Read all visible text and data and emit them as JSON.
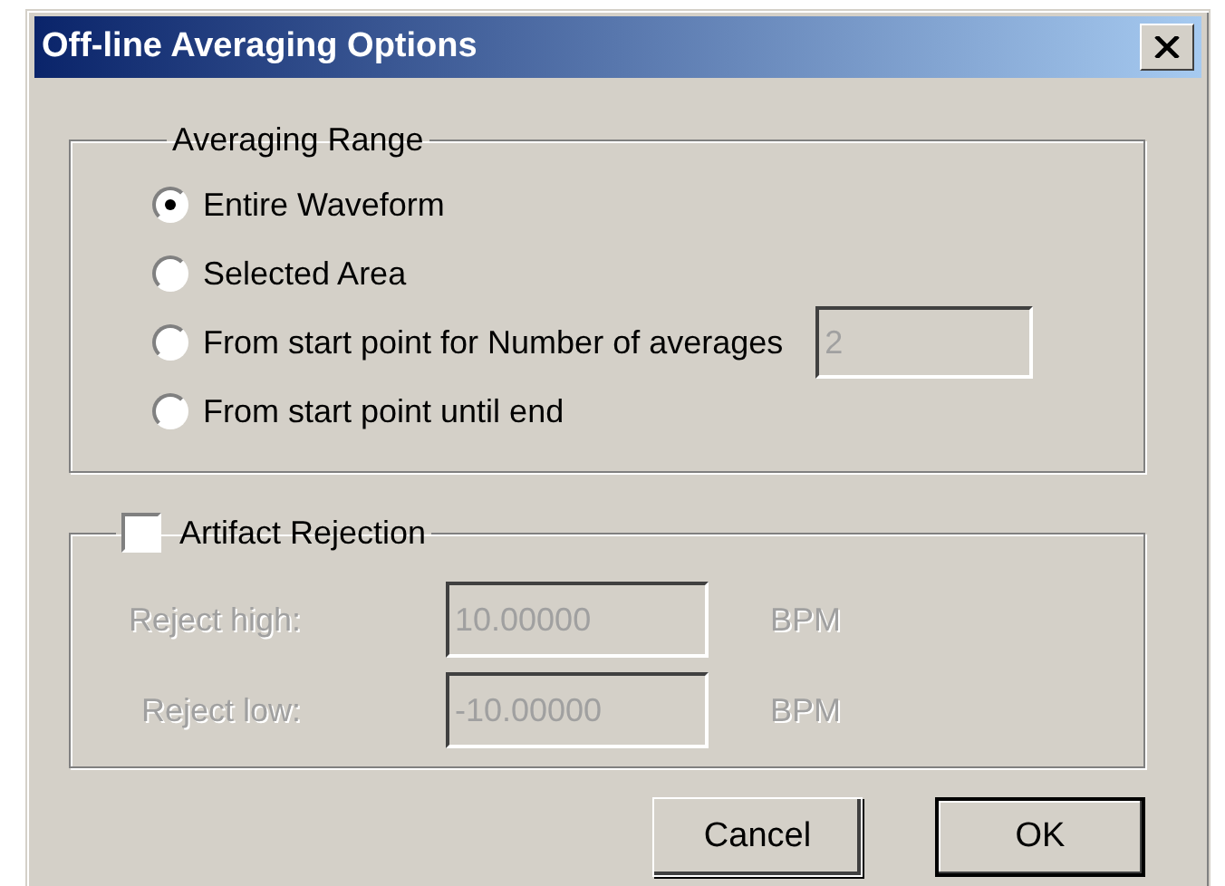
{
  "window": {
    "title": "Off-line Averaging Options"
  },
  "averaging_range": {
    "label": "Averaging Range",
    "options": [
      {
        "label": "Entire Waveform",
        "selected": true
      },
      {
        "label": "Selected Area",
        "selected": false
      },
      {
        "label": "From start point for Number of averages",
        "selected": false,
        "field": {
          "value": "2",
          "disabled": true
        }
      },
      {
        "label": "From start point until end",
        "selected": false
      }
    ]
  },
  "artifact_rejection": {
    "label": "Artifact Rejection",
    "checked": false,
    "fields": [
      {
        "label": "Reject high:",
        "value": "10.00000",
        "unit": "BPM",
        "disabled": true
      },
      {
        "label": "Reject low:",
        "value": "-10.00000",
        "unit": "BPM",
        "disabled": true
      }
    ]
  },
  "buttons": [
    {
      "label": "Cancel",
      "default": false
    },
    {
      "label": "OK",
      "default": true
    }
  ]
}
